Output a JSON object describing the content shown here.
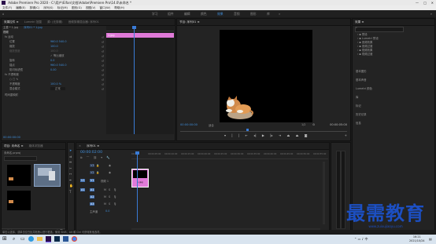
{
  "window": {
    "title": "Adobe Premiere Pro 2020 - C:\\用户\\Eifan\\文档\\Adobe\\Premiere Pro\\14.0\\未命名 *"
  },
  "menu": [
    "文件(F)",
    "编辑(E)",
    "剪辑(C)",
    "序列(S)",
    "标记(M)",
    "图形(G)",
    "视图(V)",
    "窗口(W)",
    "帮助(H)"
  ],
  "workspaces": [
    "学习",
    "组件",
    "编辑",
    "颜色",
    "效果",
    "音频",
    "图形",
    "库"
  ],
  "workspace_active_index": 4,
  "effect_controls": {
    "tabs": [
      "效果控件 ≡",
      "Lumetri 范围",
      "源: (无剪辑)",
      "音频剪辑混合器: 序列01"
    ],
    "source_label": "主要 * 1.jpg",
    "clip_label": "序列01 * 1.jpg",
    "video_label": "视频",
    "rows": [
      {
        "name": "fx  运动",
        "value": ""
      },
      {
        "name": "位置",
        "value": "960.0   540.0"
      },
      {
        "name": "缩放",
        "value": "100.0"
      },
      {
        "name": "缩放宽度",
        "value": "100.0"
      },
      {
        "name": "",
        "value": "✓ 等比缩放"
      },
      {
        "name": "旋转",
        "value": "0.0"
      },
      {
        "name": "锚点",
        "value": "960.0   540.0"
      },
      {
        "name": "防闪烁滤镜",
        "value": "0.00"
      },
      {
        "name": "fx  不透明度",
        "value": ""
      },
      {
        "name": "",
        "value": "○ □ ✎"
      },
      {
        "name": "不透明度",
        "value": "100.0 %"
      },
      {
        "name": "混合模式",
        "value": "正常"
      },
      {
        "name": "时间重映射",
        "value": ""
      }
    ],
    "timecode": "00:00:00:00",
    "clip_bar_label": "1.jpg"
  },
  "program": {
    "tab": "节目: 序列01 ≡",
    "timecode_left": "00:00:00:00",
    "fit": "适合",
    "quality": "1/2",
    "timecode_right": "00:00:05:00",
    "controls": [
      "mark-in",
      "mark-out",
      "go-to-in",
      "step-back",
      "play",
      "step-forward",
      "go-to-out",
      "lift",
      "extract",
      "export-frame",
      "button-editor"
    ]
  },
  "effects": {
    "tab": "效果 ≡",
    "items": [
      "预设",
      "Lumetri 预设",
      "音频效果",
      "音频过渡",
      "视频效果",
      "视频过渡"
    ],
    "sections": [
      "基本图形",
      "基本声音",
      "Lumetri 颜色",
      "库",
      "标记",
      "历史记录",
      "信息"
    ]
  },
  "project": {
    "tabs": [
      "项目: 未命名 ≡",
      "媒体浏览器"
    ],
    "file_label": "未命名.prproj"
  },
  "timeline": {
    "tab": "序列01 ≡",
    "timecode": "00:00:02:00",
    "ruler": [
      "00:00",
      "00:00:05:00",
      "00:00:10:00",
      "00:00:15:00",
      "00:00:20:00",
      "00:00:25:00",
      "00:00:30:00",
      "00:00:35:00",
      "00:00:40:00",
      "00:00:45:00",
      "00:00:50:00",
      "00:00:55:00"
    ],
    "tracks": [
      {
        "id": "V3",
        "kind": "video"
      },
      {
        "id": "V2",
        "kind": "video"
      },
      {
        "id": "V1",
        "kind": "video",
        "name": "视频 1"
      },
      {
        "id": "A1",
        "kind": "audio"
      },
      {
        "id": "A2",
        "kind": "audio"
      },
      {
        "id": "A3",
        "kind": "audio"
      }
    ],
    "master_label": "主声道",
    "master_value": "0.0",
    "clip_label": "1.jpg"
  },
  "status": {
    "text": "单击以选择，或单击空白处并拖拽以进行框选。使用 Shift、Alt 和 Ctrl 可获得其他选项。"
  },
  "taskbar": {
    "time": "16:21",
    "date": "2021/10/24"
  },
  "watermark": {
    "text": "最需教育",
    "sub": "www.zuixujiaoyu.com"
  },
  "colors": {
    "accent": "#3f8dd9",
    "clip": "#e07ad8",
    "playhead": "#3a7bd5",
    "watermark": "#1c4fc2"
  }
}
